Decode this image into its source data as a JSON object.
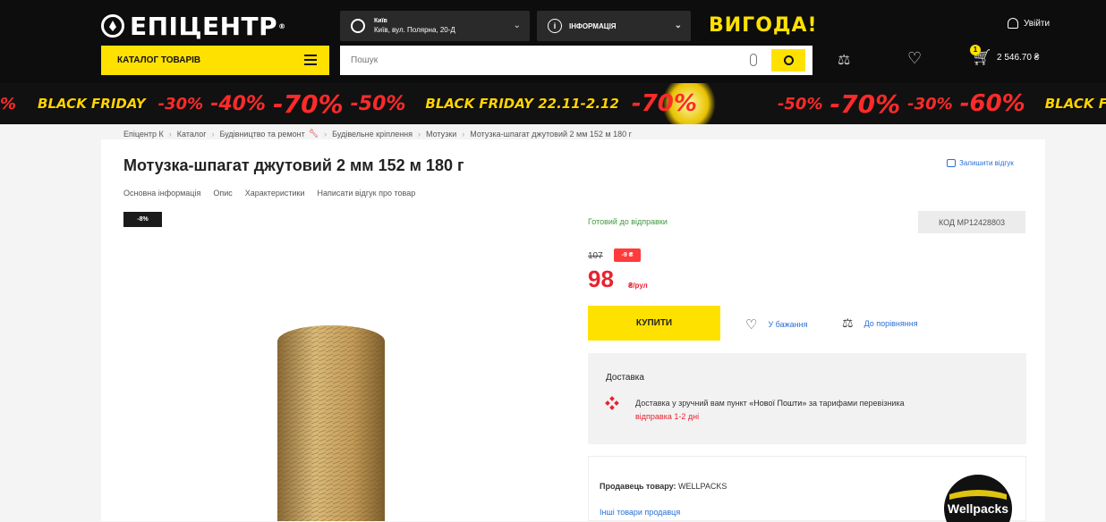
{
  "header": {
    "logo_text": "ЕПІЦЕНТР",
    "logo_reg": "®",
    "city": {
      "name": "Київ",
      "address": "Київ, вул. Полярна, 20-Д"
    },
    "info_label": "Інформація",
    "promo_word": "ВИГОДА!",
    "login_label": "Увійти",
    "catalog_label": "КАТАЛОГ ТОВАРІВ",
    "search_placeholder": "Пошук",
    "cart_count": "1",
    "cart_total": "2 546.70 ₴",
    "icons": {
      "location": "location-pin-icon",
      "info": "info-icon",
      "user": "user-icon",
      "menu": "menu-icon",
      "mic": "microphone-icon",
      "search": "search-icon",
      "compare": "scales-icon",
      "wishlist": "heart-icon",
      "cart": "cart-icon"
    },
    "colors": {
      "header_bg": "#0d0d0d",
      "accent_yellow": "#ffe100",
      "price_red": "#e8222f"
    }
  },
  "banner": {
    "items": [
      "%",
      "BLACK FRIDAY",
      "-30%",
      "-40%",
      "-70%",
      "-50%",
      "BLACK FRIDAY 22.11-2.12",
      "-70%",
      "-50%",
      "-70%",
      "-30%",
      "-60%",
      "BLACK FRIDAY"
    ]
  },
  "breadcrumb": [
    "Епіцентр К",
    "Каталог",
    "Будівництво та ремонт",
    "Будівельне кріплення",
    "Мотузки",
    "Мотузка-шпагат джутовий 2 мм 152 м 180 г"
  ],
  "product": {
    "title": "Мотузка-шпагат джутовий 2 мм 152 м 180 г",
    "write_review": "Залишити відгук",
    "tabs": [
      "Основна інформація",
      "Опис",
      "Характеристики",
      "Написати відгук про товар"
    ],
    "discount_badge": "-8%",
    "stock_status": "Готовий до відправки",
    "code": "КОД MP12428803",
    "old_price": "107",
    "price_discount": "-9 ₴",
    "price": "98",
    "unit": "₴/рул",
    "buy_label": "КУПИТИ",
    "wishlist_label": "У бажання",
    "compare_label": "До порівняння"
  },
  "delivery": {
    "heading": "Доставка",
    "text_prefix": "Доставка у зручний вам пункт ",
    "carrier": "«Нової Пошти»",
    "text_suffix": " за тарифами перевізника",
    "dispatch": "відправка 1-2 дні"
  },
  "seller": {
    "label": "Продавець товару:",
    "name": "WELLPACKS",
    "other_link": "Інші товари продавця",
    "logo_text": "Wellpacks"
  }
}
